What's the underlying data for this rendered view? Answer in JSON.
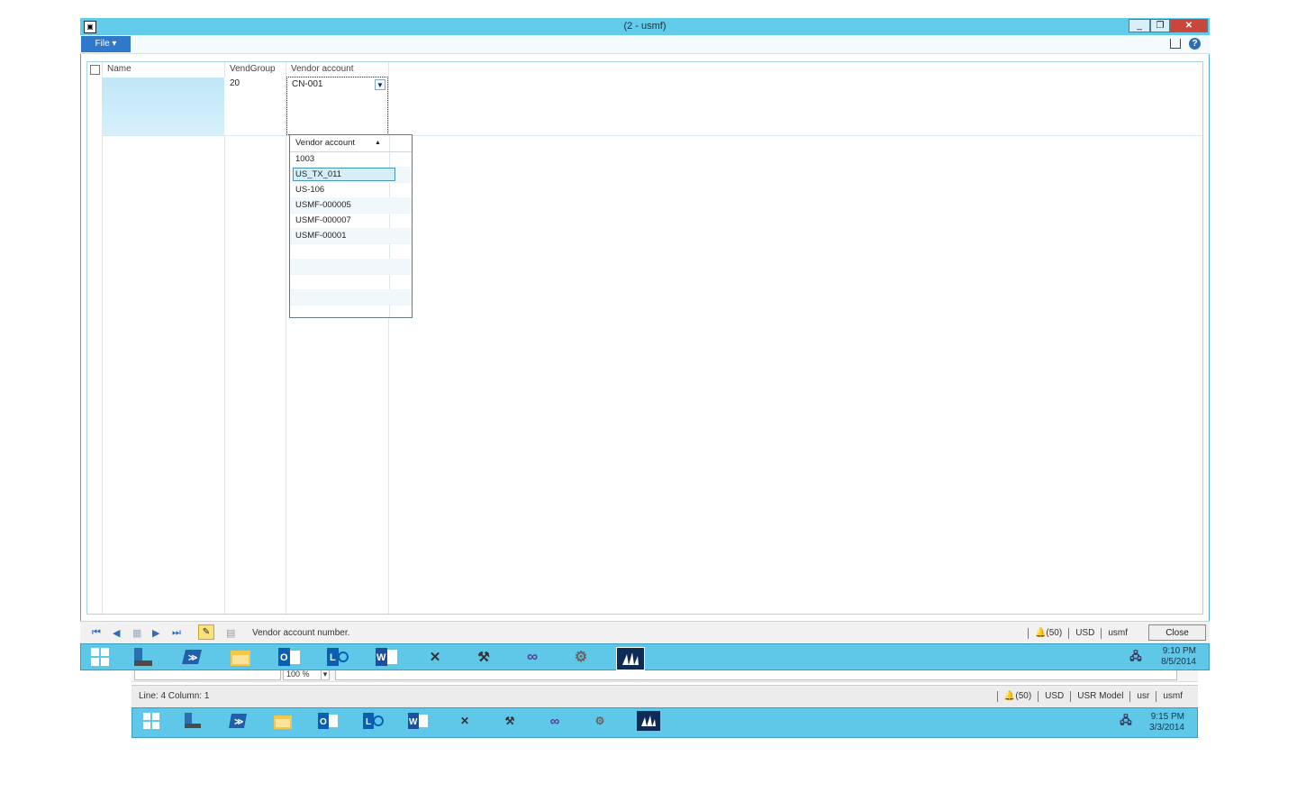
{
  "window": {
    "title": "(2 - usmf)",
    "app_icon": "ax-app-icon",
    "minimize": "_",
    "restore": "❐",
    "close": "✕"
  },
  "ribbon": {
    "file_label": "File ▾",
    "help_icon": "?"
  },
  "grid": {
    "columns": [
      "Name",
      "VendGroup",
      "Vendor account"
    ],
    "rows": [
      {
        "name": "",
        "vendgroup": "20",
        "vendor_account": "CN-001"
      }
    ]
  },
  "lookup": {
    "header": "Vendor account",
    "sort_indicator": "▲",
    "items": [
      "1003",
      "US_TX_011",
      "US-106",
      "USMF-000005",
      "USMF-000007",
      "USMF-00001"
    ],
    "selected": "US_TX_011"
  },
  "status": {
    "help_text": "Vendor account number.",
    "notifications": "(50)",
    "currency": "USD",
    "company": "usmf",
    "close_label": "Close"
  },
  "taskbar": {
    "time": "9:10 PM",
    "date": "8/5/2014"
  },
  "bg_window": {
    "zoom": "100 %",
    "status_text": "Line: 4 Column: 1",
    "notifications": "(50)",
    "currency": "USD",
    "model": "USR Model",
    "layer": "usr",
    "company": "usmf",
    "time": "9:15 PM",
    "date": "3/3/2014"
  }
}
